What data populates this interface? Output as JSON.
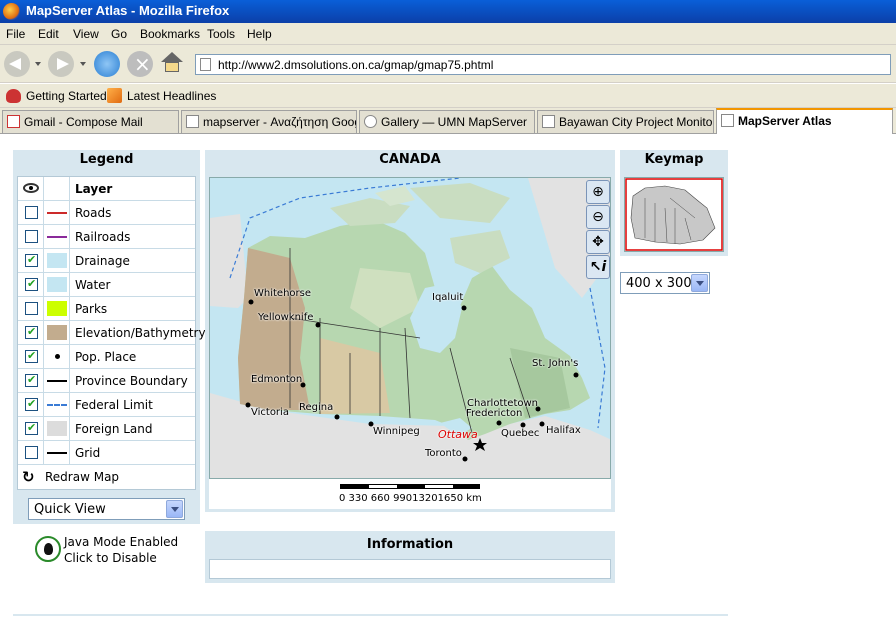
{
  "window": {
    "title": "MapServer Atlas - Mozilla Firefox"
  },
  "menu": [
    "File",
    "Edit",
    "View",
    "Go",
    "Bookmarks",
    "Tools",
    "Help"
  ],
  "urlbar": {
    "value": "http://www2.dmsolutions.on.ca/gmap/gmap75.phtml"
  },
  "bookmarks": [
    "Getting Started",
    "Latest Headlines"
  ],
  "tabs": [
    {
      "label": "Gmail - Compose Mail"
    },
    {
      "label": "mapserver - Αναζήτηση Google"
    },
    {
      "label": "Gallery — UMN MapServer"
    },
    {
      "label": "Bayawan City Project Monito..."
    },
    {
      "label": "MapServer Atlas"
    }
  ],
  "legend": {
    "title": "Legend",
    "header": "Layer",
    "layers": [
      {
        "name": "Roads",
        "checked": false,
        "symbol": "line",
        "color": "#cc2a2a"
      },
      {
        "name": "Railroads",
        "checked": false,
        "symbol": "line",
        "color": "#8a2a9a"
      },
      {
        "name": "Drainage",
        "checked": true,
        "symbol": "fill",
        "color": "#c4e6f2"
      },
      {
        "name": "Water",
        "checked": true,
        "symbol": "fill",
        "color": "#c4e6f2"
      },
      {
        "name": "Parks",
        "checked": false,
        "symbol": "fill",
        "color": "#ccff00"
      },
      {
        "name": "Elevation/Bathymetry",
        "checked": true,
        "symbol": "fill",
        "color": "#c2ac8e"
      },
      {
        "name": "Pop. Place",
        "checked": true,
        "symbol": "dot",
        "color": "#000000"
      },
      {
        "name": "Province Boundary",
        "checked": true,
        "symbol": "line",
        "color": "#000000"
      },
      {
        "name": "Federal Limit",
        "checked": true,
        "symbol": "dash",
        "color": "#3a7bd5"
      },
      {
        "name": "Foreign Land",
        "checked": true,
        "symbol": "fill",
        "color": "#dcdcdc"
      },
      {
        "name": "Grid",
        "checked": false,
        "symbol": "line",
        "color": "#000000"
      }
    ],
    "redraw_label": "Redraw Map",
    "quickview": "Quick View"
  },
  "java": {
    "line1": "Java Mode Enabled",
    "line2": "Click to Disable"
  },
  "map": {
    "title": "CANADA",
    "cities": [
      {
        "name": "Whitehorse",
        "cls": ""
      },
      {
        "name": "Yellowknife",
        "cls": ""
      },
      {
        "name": "Iqaluit",
        "cls": ""
      },
      {
        "name": "St. John's",
        "cls": ""
      },
      {
        "name": "Edmonton",
        "cls": ""
      },
      {
        "name": "Victoria",
        "cls": ""
      },
      {
        "name": "Regina",
        "cls": ""
      },
      {
        "name": "Winnipeg",
        "cls": ""
      },
      {
        "name": "Ottawa",
        "cls": "capital"
      },
      {
        "name": "Toronto",
        "cls": ""
      },
      {
        "name": "Charlottetown",
        "cls": ""
      },
      {
        "name": "Fredericton",
        "cls": ""
      },
      {
        "name": "Quebec",
        "cls": ""
      },
      {
        "name": "Halifax",
        "cls": ""
      }
    ],
    "scale_text": "0   330  660  99013201650  km"
  },
  "info": {
    "title": "Information"
  },
  "keymap": {
    "title": "Keymap",
    "size": "400 x 300"
  }
}
